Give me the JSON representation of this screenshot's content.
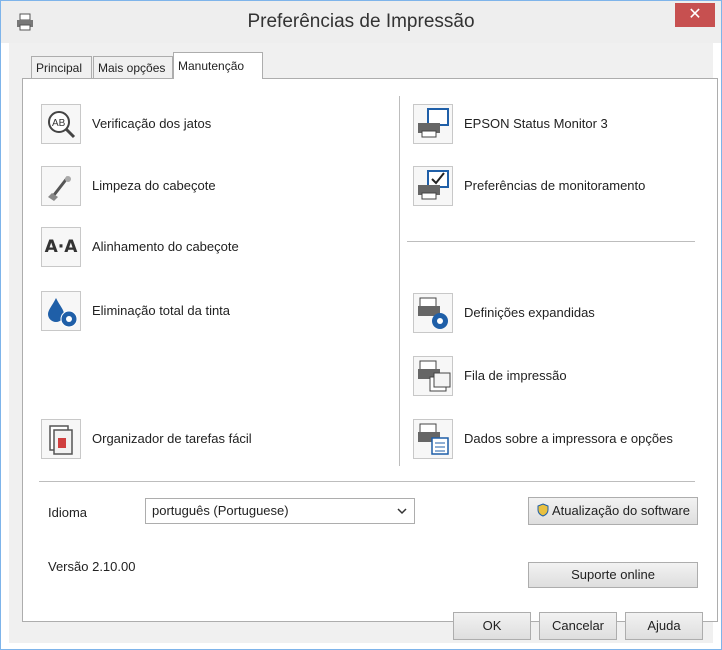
{
  "window": {
    "title": "Preferências de Impressão",
    "close_glyph": "✕"
  },
  "tabs": [
    {
      "label": "Principal"
    },
    {
      "label": "Mais opções"
    },
    {
      "label": "Manutenção"
    }
  ],
  "left_items": [
    {
      "label": "Verificação dos jatos",
      "icon": "nozzle-check-icon"
    },
    {
      "label": "Limpeza do cabeçote",
      "icon": "head-cleaning-icon"
    },
    {
      "label": "Alinhamento do cabeçote",
      "icon": "head-alignment-icon",
      "icon_text": "A·A"
    },
    {
      "label": "Eliminação total da tinta",
      "icon": "ink-flush-icon"
    },
    {
      "label": "Organizador de tarefas fácil",
      "icon": "job-arranger-icon"
    }
  ],
  "right_items": [
    {
      "label": "EPSON Status Monitor 3",
      "icon": "status-monitor-icon"
    },
    {
      "label": "Preferências de monitoramento",
      "icon": "monitoring-preferences-icon"
    },
    {
      "label": "Definições expandidas",
      "icon": "extended-settings-icon"
    },
    {
      "label": "Fila de impressão",
      "icon": "print-queue-icon"
    },
    {
      "label": "Dados sobre a impressora e opções",
      "icon": "printer-info-icon"
    }
  ],
  "language": {
    "label": "Idioma",
    "value": "português (Portuguese)"
  },
  "software_update_button": "Atualização do software",
  "version": "Versão 2.10.00",
  "online_support_button": "Suporte online",
  "footer": {
    "ok": "OK",
    "cancel": "Cancelar",
    "help": "Ajuda"
  },
  "colors": {
    "accent_blue": "#1f5fa8",
    "close_red": "#c75050",
    "frame_bg": "#f0f0f0"
  }
}
